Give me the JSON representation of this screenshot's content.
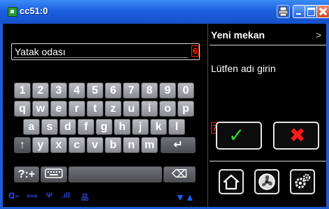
{
  "window": {
    "title": "cc51:0"
  },
  "input": {
    "value": "Yatak odası",
    "badge": "6"
  },
  "keyboard": {
    "row1": [
      "1",
      "2",
      "3",
      "4",
      "5",
      "6",
      "7",
      "8",
      "9",
      "0"
    ],
    "row2": [
      "q",
      "w",
      "e",
      "r",
      "t",
      "z",
      "u",
      "i",
      "o",
      "p"
    ],
    "row3": [
      "a",
      "s",
      "d",
      "f",
      "g",
      "h",
      "j",
      "k",
      "l"
    ],
    "row4": [
      "y",
      "x",
      "c",
      "v",
      "b",
      "n",
      "m"
    ],
    "shift_symbol": "↑",
    "enter_symbol": "↵",
    "symbols_label": "?:+",
    "backspace_symbol": "⌫"
  },
  "panel": {
    "title": "Yeni mekan",
    "prompt": "Lütfen adı girin",
    "ok_symbol": "✓",
    "cancel_symbol": "✖",
    "ok_badge": "7"
  },
  "colors": {
    "titlebar": "#1d5fe0",
    "ok": "#2dd63a",
    "cancel": "#ff1a1a",
    "badge": "#ff2a00"
  }
}
